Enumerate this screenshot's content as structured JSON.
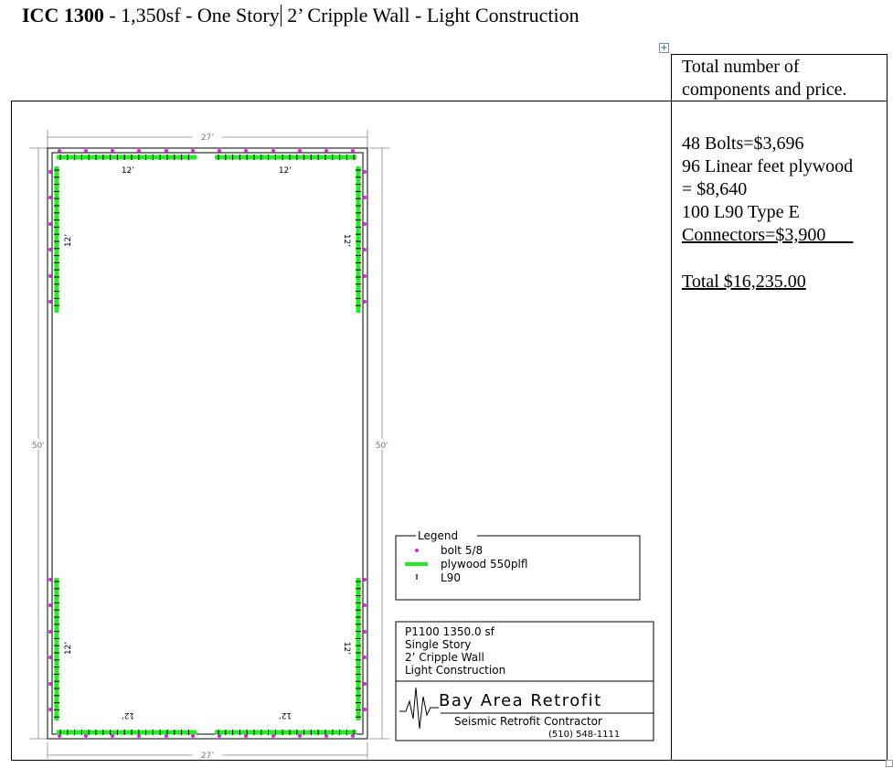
{
  "title": {
    "bold": "ICC 1300",
    "before_cursor": " - 1,350sf - One Story",
    "after_cursor": " 2’ Cripple Wall - Light Construction"
  },
  "components": {
    "header_line1": "Total number of",
    "header_line2": "components and price.",
    "lines": [
      "48 Bolts=$3,696",
      "96 Linear feet  plywood",
      "= $8,640",
      "100  L90  Type E",
      "Connectors=$3,900___"
    ],
    "total": "Total $16,235.00"
  },
  "plan": {
    "top_dim": "27’",
    "bottom_dim": "27’",
    "left_dim": "50’",
    "right_dim": "50’",
    "segment_label": "12’"
  },
  "legend": {
    "title": "Legend",
    "items": [
      {
        "symbol": "bolt",
        "label": "bolt 5/8",
        "color": "#e020e0"
      },
      {
        "symbol": "plywood",
        "label": "plywood 550plfl",
        "color": "#22ee22"
      },
      {
        "symbol": "l90",
        "label": "L90",
        "color": "#000000"
      }
    ]
  },
  "title_block": {
    "lines": [
      "P1100 1350.0 sf",
      "Single Story",
      "2’ Cripple Wall",
      "Light Construction"
    ],
    "company": "Bay Area Retrofit",
    "subtitle": "Seismic Retrofit Contractor",
    "phone": "(510) 548-1111"
  }
}
